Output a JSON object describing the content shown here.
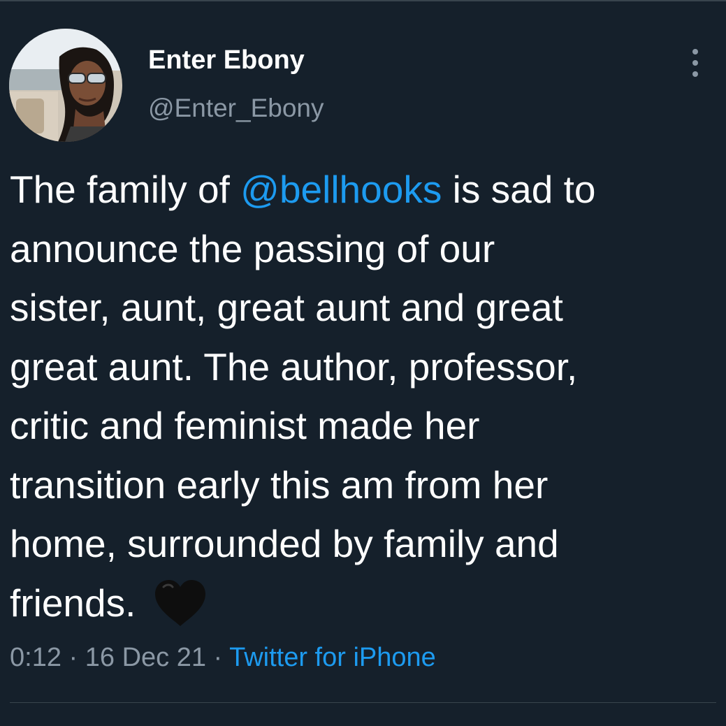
{
  "tweet": {
    "author": {
      "display_name": "Enter Ebony",
      "handle": "@Enter_Ebony"
    },
    "text": {
      "line1_before": "The family of ",
      "mention": "@bellhooks",
      "line1_after": " is sad to",
      "line2": "announce the passing of our",
      "line3": "sister, aunt, great aunt and great",
      "line4": "great aunt. The author, professor,",
      "line5": "critic and feminist made her",
      "line6": "transition early this am from her",
      "line7": "home, surrounded by family and",
      "line8": "friends. ",
      "emoji": "black-heart-icon"
    },
    "meta": {
      "time": "0:12",
      "separator": " · ",
      "date": "16 Dec 21",
      "source": "Twitter for iPhone"
    }
  },
  "colors": {
    "background": "#15202b",
    "text": "#ffffff",
    "secondary": "#8b98a5",
    "accent": "#1d9bf0",
    "divider": "#38444d"
  },
  "icons": {
    "more": "more-options-icon",
    "emoji": "black-heart-icon"
  }
}
